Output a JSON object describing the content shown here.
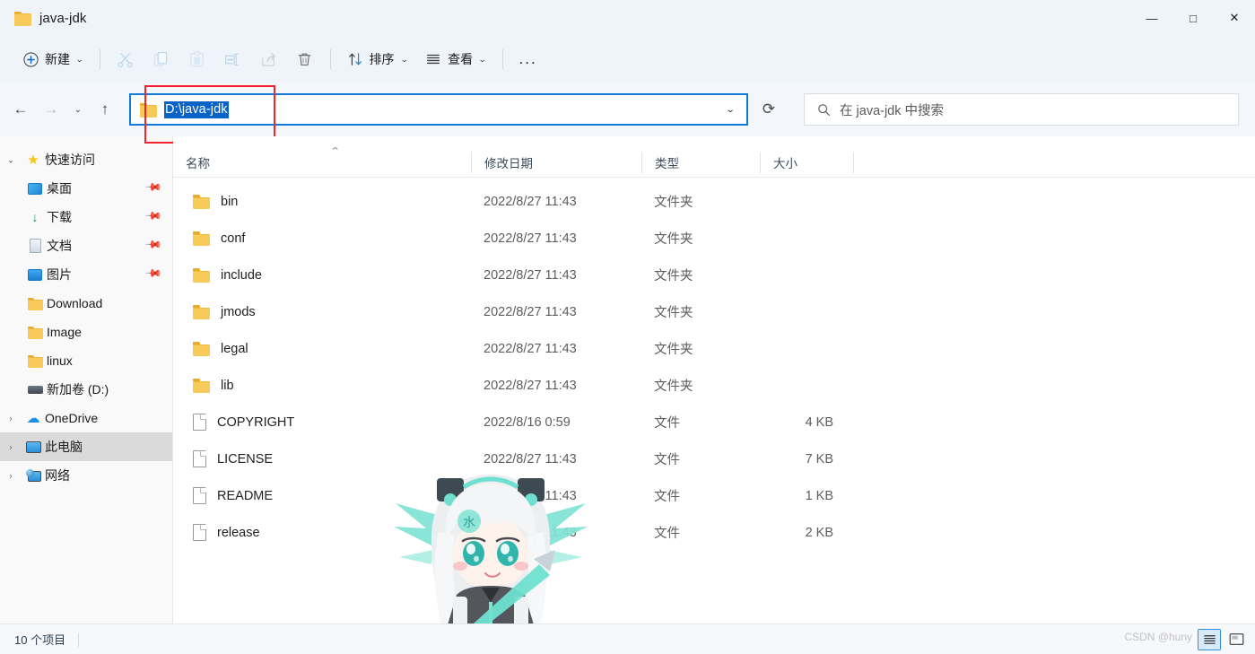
{
  "window": {
    "title": "java-jdk",
    "controls": {
      "minimize": "—",
      "maximize": "□",
      "close": "✕"
    }
  },
  "toolbar": {
    "new_label": "新建",
    "cut_label": "剪切",
    "copy_label": "复制",
    "paste_label": "粘贴",
    "rename_label": "重命名",
    "share_label": "共享",
    "delete_label": "删除",
    "sort_label": "排序",
    "view_label": "查看",
    "more_label": "..."
  },
  "address": {
    "path": "D:\\java-jdk",
    "back": "←",
    "forward": "→",
    "recent": "⌄",
    "up": "↑",
    "dropdown": "⌄",
    "refresh": "⟳"
  },
  "search": {
    "placeholder": "在 java-jdk 中搜索",
    "icon": "search-icon"
  },
  "sidebar": {
    "items": [
      {
        "label": "快速访问",
        "icon": "star-icon",
        "chevron": "⌄",
        "indent": 0,
        "pinned": false,
        "selected": false
      },
      {
        "label": "桌面",
        "icon": "desktop-icon",
        "chevron": "",
        "indent": 1,
        "pinned": true,
        "selected": false
      },
      {
        "label": "下载",
        "icon": "download-icon",
        "chevron": "",
        "indent": 1,
        "pinned": true,
        "selected": false
      },
      {
        "label": "文档",
        "icon": "document-icon",
        "chevron": "",
        "indent": 1,
        "pinned": true,
        "selected": false
      },
      {
        "label": "图片",
        "icon": "pictures-icon",
        "chevron": "",
        "indent": 1,
        "pinned": true,
        "selected": false
      },
      {
        "label": "Download",
        "icon": "folder-icon",
        "chevron": "",
        "indent": 1,
        "pinned": false,
        "selected": false
      },
      {
        "label": "Image",
        "icon": "folder-icon",
        "chevron": "",
        "indent": 1,
        "pinned": false,
        "selected": false
      },
      {
        "label": "linux",
        "icon": "folder-icon",
        "chevron": "",
        "indent": 1,
        "pinned": false,
        "selected": false
      },
      {
        "label": "新加卷 (D:)",
        "icon": "drive-icon",
        "chevron": "",
        "indent": 1,
        "pinned": false,
        "selected": false
      },
      {
        "label": "OneDrive",
        "icon": "cloud-icon",
        "chevron": "›",
        "indent": 0,
        "pinned": false,
        "selected": false
      },
      {
        "label": "此电脑",
        "icon": "this-pc-icon",
        "chevron": "›",
        "indent": 0,
        "pinned": false,
        "selected": true
      },
      {
        "label": "网络",
        "icon": "network-icon",
        "chevron": "›",
        "indent": 0,
        "pinned": false,
        "selected": false
      }
    ]
  },
  "filelist": {
    "sort_indicator": "⌃",
    "columns": [
      {
        "key": "name",
        "label": "名称"
      },
      {
        "key": "date",
        "label": "修改日期"
      },
      {
        "key": "type",
        "label": "类型"
      },
      {
        "key": "size",
        "label": "大小"
      }
    ],
    "rows": [
      {
        "name": "bin",
        "date": "2022/8/27 11:43",
        "type": "文件夹",
        "size": "",
        "kind": "folder"
      },
      {
        "name": "conf",
        "date": "2022/8/27 11:43",
        "type": "文件夹",
        "size": "",
        "kind": "folder"
      },
      {
        "name": "include",
        "date": "2022/8/27 11:43",
        "type": "文件夹",
        "size": "",
        "kind": "folder"
      },
      {
        "name": "jmods",
        "date": "2022/8/27 11:43",
        "type": "文件夹",
        "size": "",
        "kind": "folder"
      },
      {
        "name": "legal",
        "date": "2022/8/27 11:43",
        "type": "文件夹",
        "size": "",
        "kind": "folder"
      },
      {
        "name": "lib",
        "date": "2022/8/27 11:43",
        "type": "文件夹",
        "size": "",
        "kind": "folder"
      },
      {
        "name": "COPYRIGHT",
        "date": "2022/8/16 0:59",
        "type": "文件",
        "size": "4 KB",
        "kind": "file"
      },
      {
        "name": "LICENSE",
        "date": "2022/8/27 11:43",
        "type": "文件",
        "size": "7 KB",
        "kind": "file"
      },
      {
        "name": "README",
        "date": "2022/8/27 11:43",
        "type": "文件",
        "size": "1 KB",
        "kind": "file"
      },
      {
        "name": "release",
        "date": "2022/8/27 11:43",
        "type": "文件",
        "size": "2 KB",
        "kind": "file"
      }
    ]
  },
  "statusbar": {
    "item_count": "10 个项目",
    "watermark": "CSDN @huny",
    "details_view": "details-view-icon",
    "large_icons_view": "large-icons-view-icon"
  },
  "colors": {
    "accent": "#0a64c8",
    "annotation": "#f5222d",
    "folder": "#f8ca5a",
    "titlebar_bg": "#eff3fa"
  }
}
